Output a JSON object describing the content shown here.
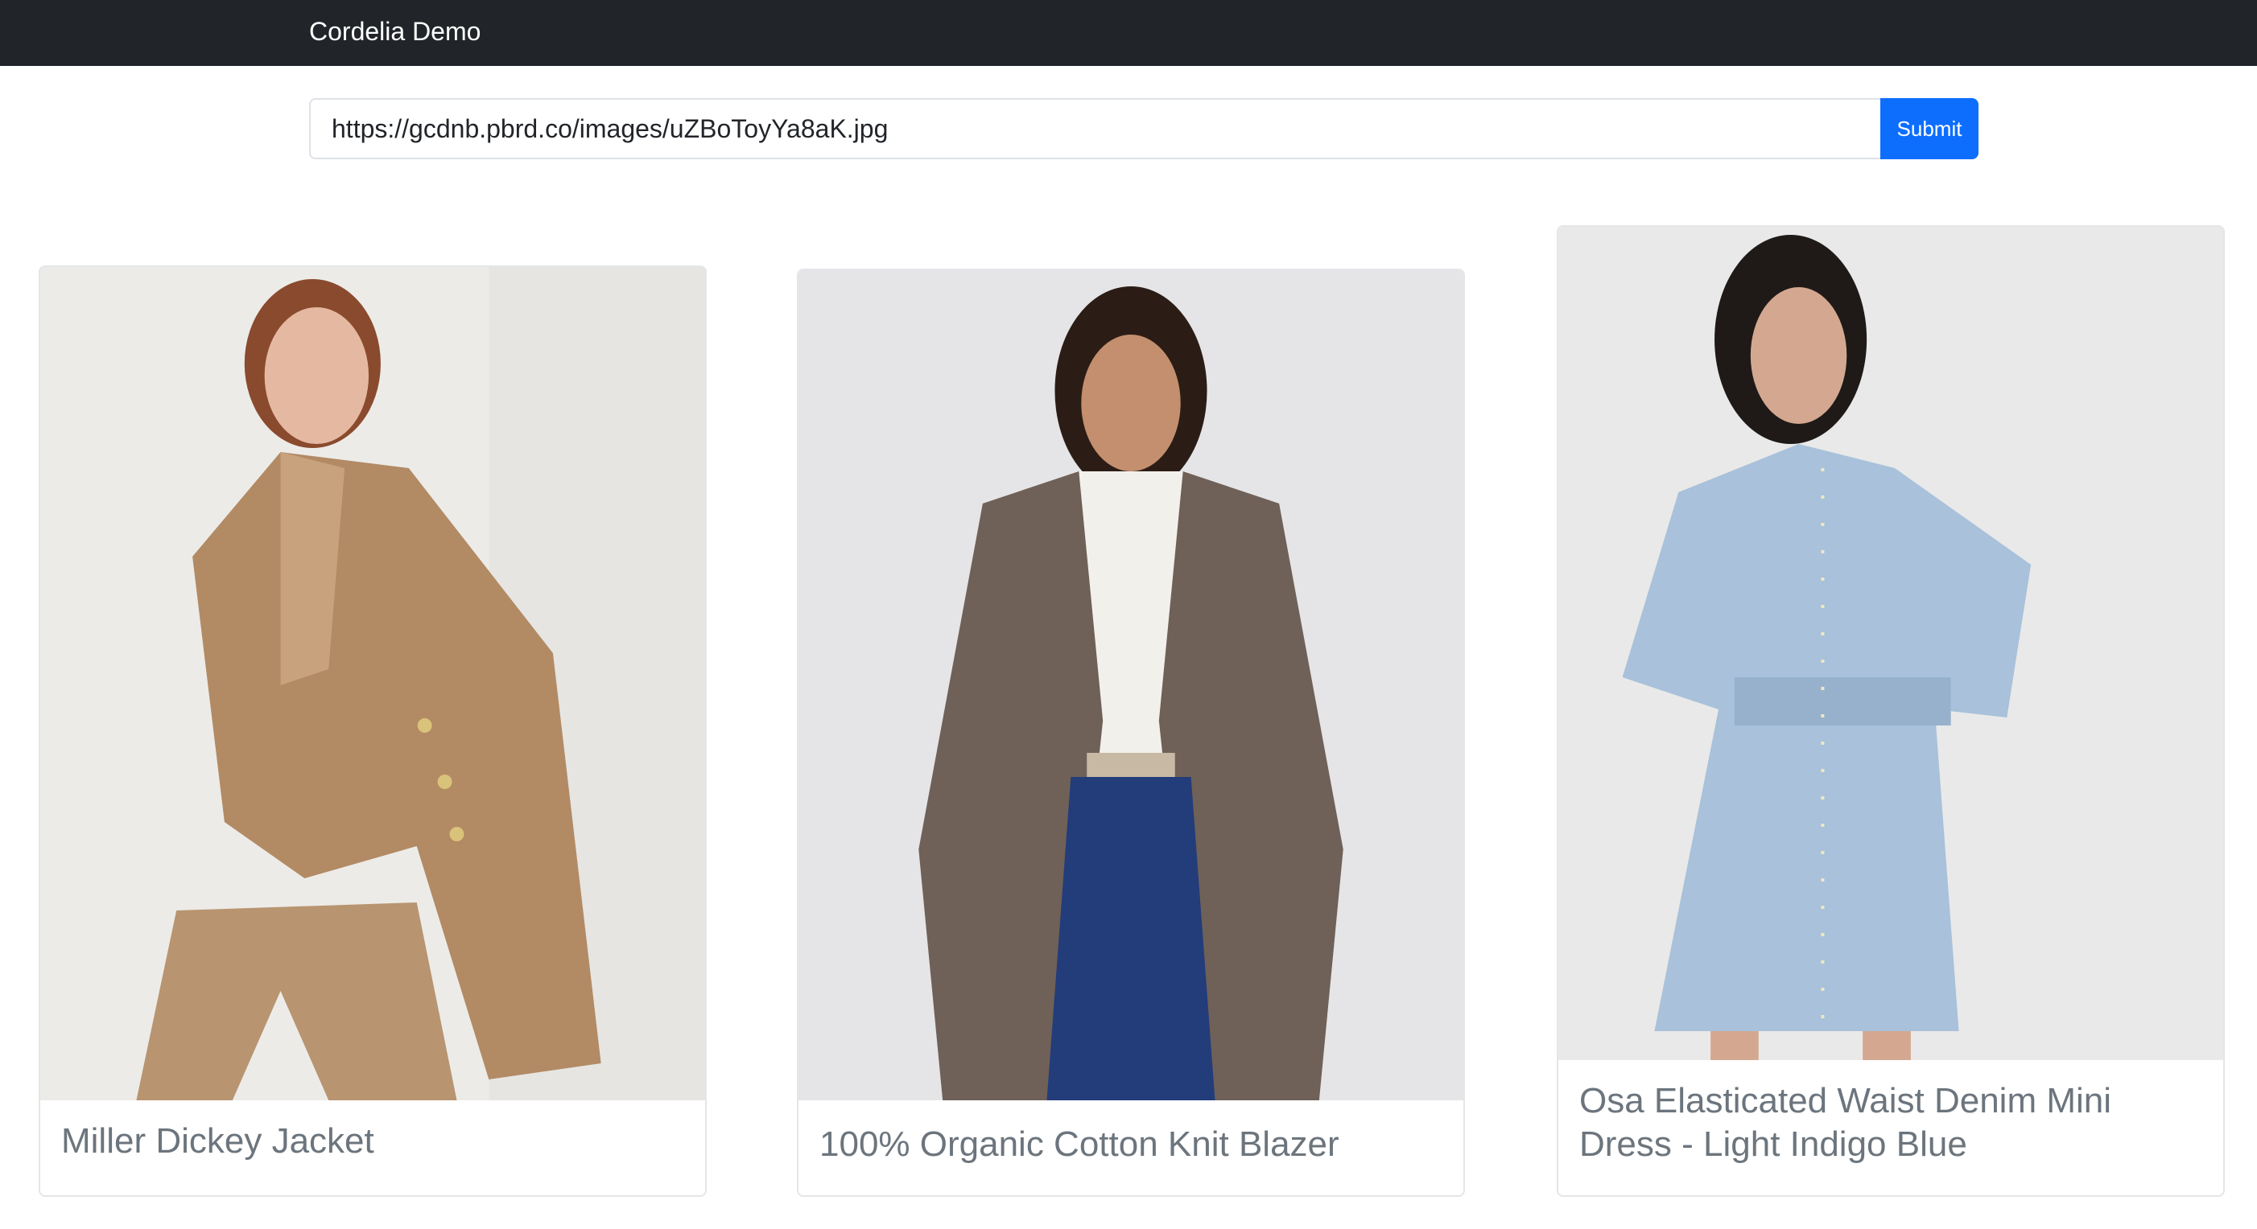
{
  "navbar": {
    "brand": "Cordelia Demo"
  },
  "search": {
    "url_value": "https://gcdnb.pbrd.co/images/uZBoToyYa8aK.jpg",
    "submit_label": "Submit"
  },
  "products": [
    {
      "title": "Miller Dickey Jacket"
    },
    {
      "title": "100% Organic Cotton Knit Blazer"
    },
    {
      "title": "Osa Elasticated Waist Denim Mini Dress - Light Indigo Blue"
    }
  ],
  "colors": {
    "navbar_bg": "#212529",
    "submit_bg": "#0d6efd",
    "title_text": "#6c757d"
  }
}
